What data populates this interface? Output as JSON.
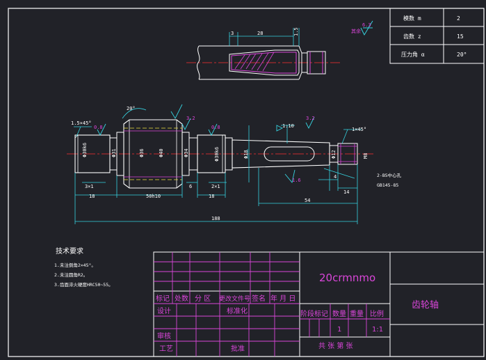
{
  "params": [
    {
      "label": "模数 m",
      "value": "2"
    },
    {
      "label": "齿数 z",
      "value": "15"
    },
    {
      "label": "压力角 α",
      "value": "20°"
    }
  ],
  "top_view": {
    "dim_keyway_offset": "3",
    "dim_keyway_len": "28",
    "dim_depth": "1.5",
    "roughness_other": "6.3",
    "roughness_other_label": "其余"
  },
  "main_view": {
    "chamfer_left": "1.5×45°",
    "chamfer_right": "1×45°",
    "roughness_1": "0.8",
    "roughness_2": "3.2",
    "roughness_3": "0.8",
    "roughness_4": "3.2",
    "roughness_5": "1.6",
    "angle": "20°",
    "taper": "1:10",
    "dia_1": "Φ30k6",
    "dia_2": "Φ31",
    "dia_3": "Φ36",
    "dia_4": "Φ40",
    "dia_5": "Φ34",
    "dia_6": "Φ30k6",
    "dia_7": "Φ18",
    "dia_8": "Φ12",
    "dia_9": "M8",
    "undercut_1": "3×1",
    "undercut_2": "6",
    "undercut_3": "2×1",
    "len_1": "18",
    "len_2": "50h10",
    "len_3": "18",
    "len_4": "4",
    "len_5": "14",
    "len_6": "54",
    "len_7": "188",
    "center_hole_1": "2-B5中心孔",
    "center_hole_2": "GB145-85"
  },
  "tech_req": {
    "title": "技术要求",
    "items": [
      "1.未注倒角2×45°。",
      "2.未注圆角R2。",
      "3.齿面淬火硬度HRC50~55。"
    ]
  },
  "title_block": {
    "material": "20crmnmo",
    "part_name": "齿轮轴",
    "hdr": [
      "标记",
      "处数",
      "分 区",
      "更改文件号",
      "签名",
      "年 月 日"
    ],
    "design": "设计",
    "standardize": "标准化",
    "review": "审核",
    "process": "工艺",
    "approve": "批准",
    "stage_mark": "阶段标记",
    "quantity": "数量",
    "weight": "重量",
    "scale": "比例",
    "quantity_value": "1",
    "scale_value": "1:1",
    "sheets": "共  张  第  张"
  }
}
